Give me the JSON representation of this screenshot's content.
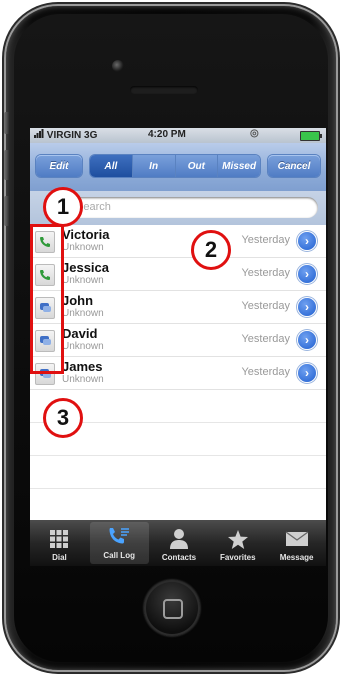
{
  "status": {
    "carrier": "VIRGIN 3G",
    "time": "4:20 PM"
  },
  "toolbar": {
    "edit": "Edit",
    "cancel": "Cancel",
    "filters": [
      "All",
      "In",
      "Out",
      "Missed"
    ],
    "active_filter": "All"
  },
  "search": {
    "placeholder": "Search"
  },
  "calls": [
    {
      "name": "Victoria",
      "label": "Unknown",
      "when": "Yesterday",
      "type": "phone"
    },
    {
      "name": "Jessica",
      "label": "Unknown",
      "when": "Yesterday",
      "type": "phone"
    },
    {
      "name": "John",
      "label": "Unknown",
      "when": "Yesterday",
      "type": "message"
    },
    {
      "name": "David",
      "label": "Unknown",
      "when": "Yesterday",
      "type": "message"
    },
    {
      "name": "James",
      "label": "Unknown",
      "when": "Yesterday",
      "type": "message"
    }
  ],
  "tabs": [
    {
      "label": "Dial",
      "icon": "keypad-icon"
    },
    {
      "label": "Call Log",
      "icon": "call-log-icon",
      "active": true
    },
    {
      "label": "Contacts",
      "icon": "contacts-icon"
    },
    {
      "label": "Favorites",
      "icon": "star-icon"
    },
    {
      "label": "Message",
      "icon": "envelope-icon"
    }
  ],
  "callouts": [
    "1",
    "2",
    "3"
  ],
  "colors": {
    "annotation": "#e01010",
    "toolbar": "#8eacd8",
    "disclosure": "#1f5fd0"
  }
}
